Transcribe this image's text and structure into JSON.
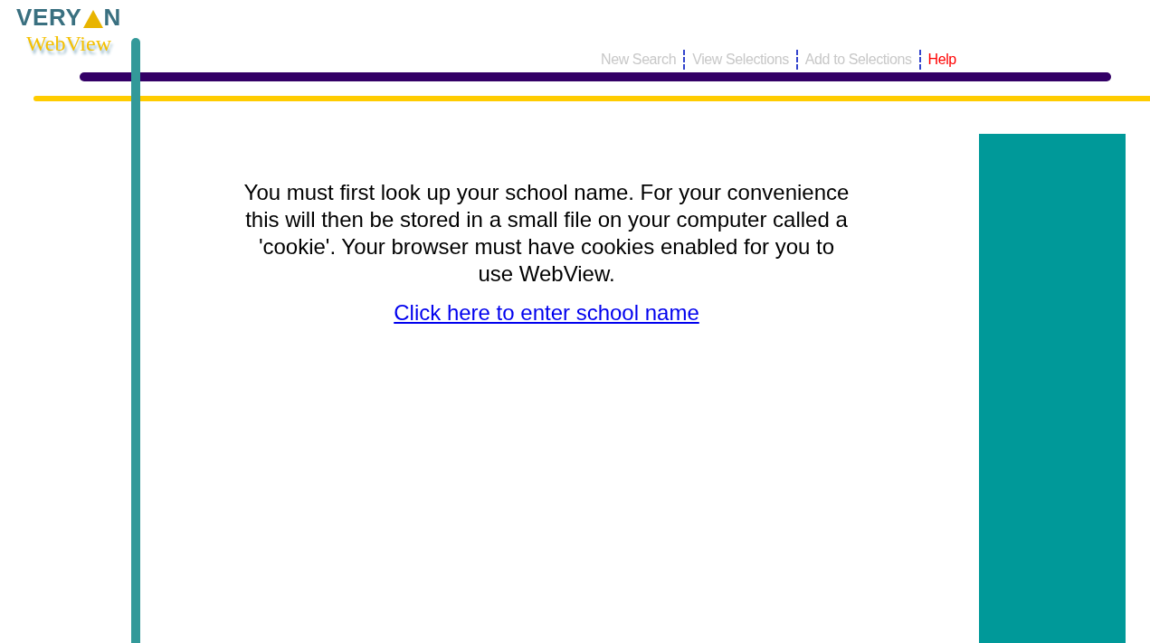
{
  "logo": {
    "brand_start": "VERY",
    "brand_end": "N",
    "product": "WebView"
  },
  "nav": [
    {
      "label": "New Search",
      "disabled": true
    },
    {
      "label": "View Selections",
      "disabled": true
    },
    {
      "label": "Add to Selections",
      "disabled": true
    },
    {
      "label": "Help",
      "disabled": false
    }
  ],
  "message": "You must first look up your school name. For your convenience this will then be stored in a small file on your computer called a 'cookie'. Your browser must have cookies enabled for you to use WebView.",
  "link": "Click here to enter school name"
}
